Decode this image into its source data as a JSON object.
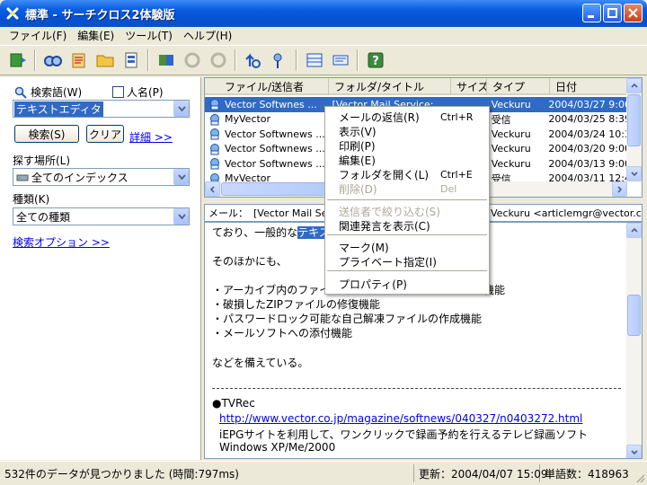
{
  "window": {
    "title": "標準 - サーチクロス2体験版"
  },
  "menu": [
    "ファイル(F)",
    "編集(E)",
    "ツール(T)",
    "ヘルプ(H)"
  ],
  "toolbar": {
    "icons": [
      "refresh-icon",
      "find-icon",
      "index-icon",
      "folder-open-icon",
      "properties-icon",
      "export-icon",
      "filter-icon",
      "filter-off-icon",
      "up-icon",
      "pin-icon",
      "view-pane-icon",
      "view-detail-icon",
      "help-icon"
    ]
  },
  "search": {
    "keyword_label": "検索語(W)",
    "person_label": "人名(P)",
    "keyword_value": "テキストエディタ",
    "search_button": "検索(S)",
    "clear_button": "クリア",
    "detail_link": "詳細 >>",
    "location_label": "探す場所(L)",
    "location_value": "全てのインデックス",
    "type_label": "種類(K)",
    "type_value": "全ての種類",
    "options_link": "検索オプション >>"
  },
  "list": {
    "columns": [
      "ファイル/送信者",
      "フォルダ/タイトル",
      "サイズ",
      "タイプ",
      "日付"
    ],
    "rows": [
      {
        "sender": "Vector Softwnes ...",
        "title": "[Vector Mail Service:",
        "size": "",
        "type": "Veckuru",
        "date": "2004/03/27 9:00",
        "selected": true
      },
      {
        "sender": "MyVector",
        "title": "",
        "size": "",
        "type": "受信",
        "date": "2004/03/25 8:39",
        "selected": false
      },
      {
        "sender": "Vector Softwnews ...",
        "title": "",
        "size": "",
        "type": "Veckuru",
        "date": "2004/03/24 10:3",
        "selected": false
      },
      {
        "sender": "Vector Softwnews ...",
        "title": "",
        "size": "",
        "type": "Veckuru",
        "date": "2004/03/20 9:00",
        "selected": false
      },
      {
        "sender": "Vector Softwnews ...",
        "title": "",
        "size": "",
        "type": "Veckuru",
        "date": "2004/03/13 9:00",
        "selected": false
      },
      {
        "sender": "MyVector",
        "title": "",
        "size": "",
        "type": "受信",
        "date": "2004/03/11 12:4",
        "selected": false
      }
    ]
  },
  "mail": {
    "header_label": "メール：",
    "header_subject": "[Vector Mail Serv",
    "header_from": "Veckuru <articlemgr@vector.co.jp"
  },
  "body": {
    "line1_pre": "ており、一般的な",
    "line1_hl": "テキスト",
    "line2": "そのほかにも、",
    "bullets": [
      "・アーカイブ内のファイル",
      "・破損したZIPファイルの修復機能",
      "・パスワードロック可能な自己解凍ファイルの作成機能",
      "・メールソフトへの添付機能"
    ],
    "bullet1_tail": "機能",
    "closing": "などを備えている。",
    "section_title": "●TVRec",
    "section_link": "http://www.vector.co.jp/magazine/softnews/040327/n0403272.html",
    "section_desc": "iEPGサイトを利用して、ワンクリックで録画予約を行えるテレビ録画ソフト",
    "section_os": "Windows XP/Me/2000"
  },
  "context_menu": {
    "items": [
      {
        "label": "メールの返信(R)",
        "shortcut": "Ctrl+R",
        "disabled": false
      },
      {
        "label": "表示(V)",
        "shortcut": "",
        "disabled": false
      },
      {
        "label": "印刷(P)",
        "shortcut": "",
        "disabled": false
      },
      {
        "label": "編集(E)",
        "shortcut": "",
        "disabled": false
      },
      {
        "label": "フォルダを開く(L)",
        "shortcut": "Ctrl+E",
        "disabled": false
      },
      {
        "label": "削除(D)",
        "shortcut": "Del",
        "disabled": true
      },
      {
        "label": "送信者で絞り込む(S)",
        "shortcut": "",
        "disabled": true
      },
      {
        "label": "関連発言を表示(C)",
        "shortcut": "",
        "disabled": false
      },
      {
        "label": "マーク(M)",
        "shortcut": "",
        "disabled": false
      },
      {
        "label": "プライベート指定(I)",
        "shortcut": "",
        "disabled": false
      },
      {
        "label": "プロパティ(P)",
        "shortcut": "",
        "disabled": false
      }
    ]
  },
  "status": {
    "found": "532件のデータが見つかりました (時間:797ms)",
    "updated": "更新：2004/04/07 15:09",
    "words": "単語数：418963"
  }
}
